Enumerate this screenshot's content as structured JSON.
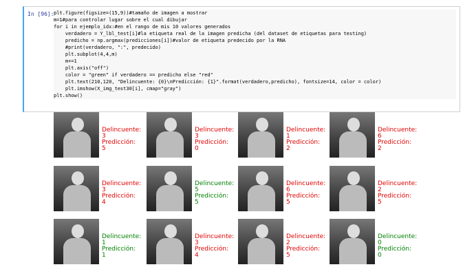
{
  "cell": {
    "prompt": "In [96]:",
    "code_lines": [
      "plt.figure(figsize=(15,9))#tamaño de imagen a mostrar",
      "m=1#para controlar lugar sobre el cual dibujar",
      "for i in ejemplo_idx:#en el rango de mis 10 valores generados",
      "    verdadero = Y_lbl_test[i]#la etiqueta real de la imagen predicha (del dataset de etiquetas para testing)",
      "    predicho = np.argmax(predicciones[i])#valor de etiqueta predecido por la RNA",
      "    #print(verdadero, \":\", predecido)",
      "    plt.subplot(4,4,m)",
      "    m+=1",
      "    plt.axis(\"off\")",
      "    color = \"green\" if verdadero == predicho else \"red\"",
      "    plt.text(210,120, \"Delincuente: {0}\\nPredicción: {1}\".format(verdadero,predicho), fontsize=14, color = color)",
      "    plt.imshow(X_img_test30[i], cmap=\"gray\")",
      "plt.show()"
    ]
  },
  "results": [
    {
      "d": "Delincuente: 3",
      "p": "Predicción: 5",
      "color": "red"
    },
    {
      "d": "Delincuente: 3",
      "p": "Predicción: 0",
      "color": "red"
    },
    {
      "d": "Delincuente: 1",
      "p": "Predicción: 2",
      "color": "red"
    },
    {
      "d": "Delincuente: 6",
      "p": "Predicción: 2",
      "color": "red"
    },
    {
      "d": "Delincuente: 3",
      "p": "Predicción: 4",
      "color": "red"
    },
    {
      "d": "Delincuente: 5",
      "p": "Predicción: 5",
      "color": "green"
    },
    {
      "d": "Delincuente: 6",
      "p": "Predicción: 5",
      "color": "red"
    },
    {
      "d": "Delincuente: 2",
      "p": "Predicción: 5",
      "color": "red"
    },
    {
      "d": "Delincuente: 1",
      "p": "Predicción: 1",
      "color": "green"
    },
    {
      "d": "Delincuente: 3",
      "p": "Predicción: 4",
      "color": "red"
    },
    {
      "d": "Delincuente: 2",
      "p": "Predicción: 5",
      "color": "red"
    },
    {
      "d": "Delincuente: 0",
      "p": "Predicción: 0",
      "color": "green"
    }
  ]
}
